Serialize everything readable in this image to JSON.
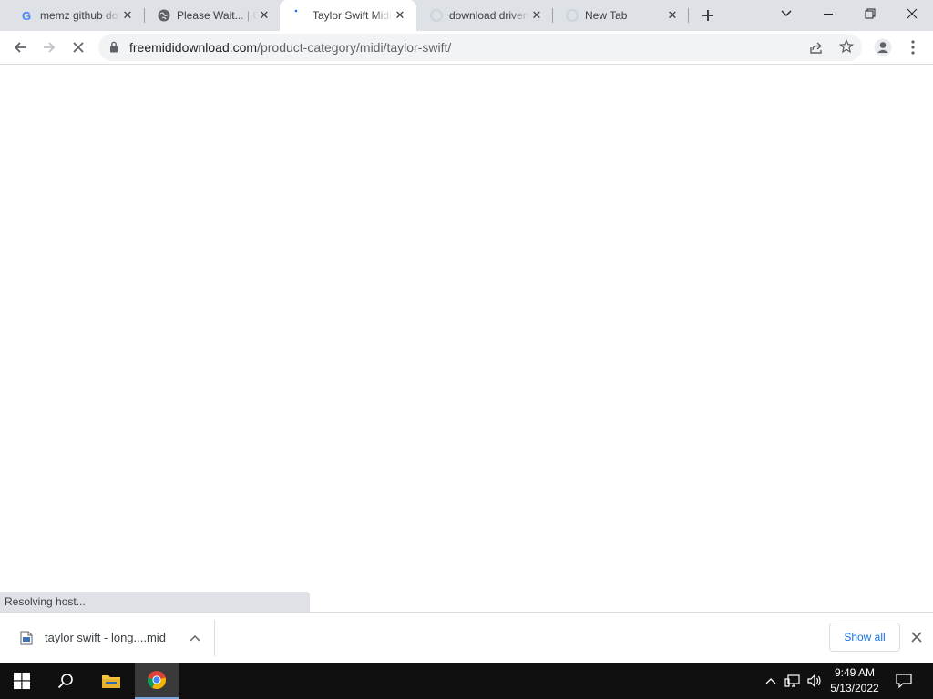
{
  "browser": {
    "tabs": [
      {
        "title": "memz github download",
        "favicon": "google-icon",
        "active": false
      },
      {
        "title": "Please Wait... | Cloudflare",
        "favicon": "globe-icon",
        "active": false
      },
      {
        "title": "Taylor Swift Midi",
        "favicon": "loading-spinner-icon",
        "active": true
      },
      {
        "title": "download drivers",
        "favicon": "loading-spinner-icon",
        "active": false
      },
      {
        "title": "New Tab",
        "favicon": "loading-spinner-icon",
        "active": false
      }
    ],
    "address": {
      "host": "freemididownload.com",
      "path": "/product-category/midi/taylor-swift/"
    },
    "status_text": "Resolving host..."
  },
  "download_shelf": {
    "file_name": "taylor swift - long....mid",
    "show_all_label": "Show all"
  },
  "taskbar": {
    "time": "9:49 AM",
    "date": "5/13/2022"
  },
  "colors": {
    "tabstrip": "#dee1e6",
    "accent": "#1a73e8",
    "taskbar": "#101010"
  }
}
